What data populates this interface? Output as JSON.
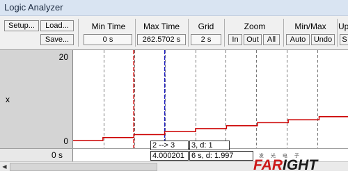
{
  "window": {
    "title": "Logic Analyzer"
  },
  "toolbar": {
    "setup_label": "Setup...",
    "load_label": "Load...",
    "save_label": "Save...",
    "min_time": {
      "label": "Min Time",
      "value": "0 s"
    },
    "max_time": {
      "label": "Max Time",
      "value": "262.5702 s"
    },
    "grid": {
      "label": "Grid",
      "value": "2 s"
    },
    "zoom": {
      "label": "Zoom",
      "in_label": "In",
      "out_label": "Out",
      "all_label": "All"
    },
    "minmax": {
      "label": "Min/Max",
      "auto_label": "Auto",
      "undo_label": "Undo"
    },
    "update": {
      "label": "Up",
      "s_label": "S"
    }
  },
  "signal_panel": {
    "signal_name": "x",
    "y_max": "20",
    "y_min": "0",
    "time_readout": "0 s"
  },
  "chart_data": {
    "type": "line",
    "series": [
      {
        "x": [
          0,
          28.5,
          28.5,
          58,
          58,
          87.5,
          87.5,
          117,
          117,
          146.5,
          146.5,
          176,
          176,
          205.5,
          205.5,
          235,
          235,
          262.57
        ],
        "y": [
          0,
          0,
          0.7,
          0.7,
          1.4,
          1.4,
          2.1,
          2.1,
          2.8,
          2.8,
          3.5,
          3.5,
          4.2,
          4.2,
          4.9,
          4.9,
          5.6,
          5.6
        ]
      }
    ],
    "xlim": [
      0,
      262.57
    ],
    "ylim": [
      0,
      20
    ],
    "grid": true,
    "cursors": {
      "red_x": 58,
      "blue_x": 87.5
    },
    "colors": {
      "signal": "#cc0000",
      "cursor_red": "#d00000",
      "cursor_blue": "#2020c0",
      "grid": "#777777"
    }
  },
  "cursor_info": {
    "transition_text": "2 --> 3",
    "value_text": "3,  d: 1",
    "time_text": "4.000201",
    "delta_text": "6 s,  d: 1.997"
  },
  "watermark": {
    "brand": "FARIGHT",
    "sub": "发 光 电 子"
  }
}
